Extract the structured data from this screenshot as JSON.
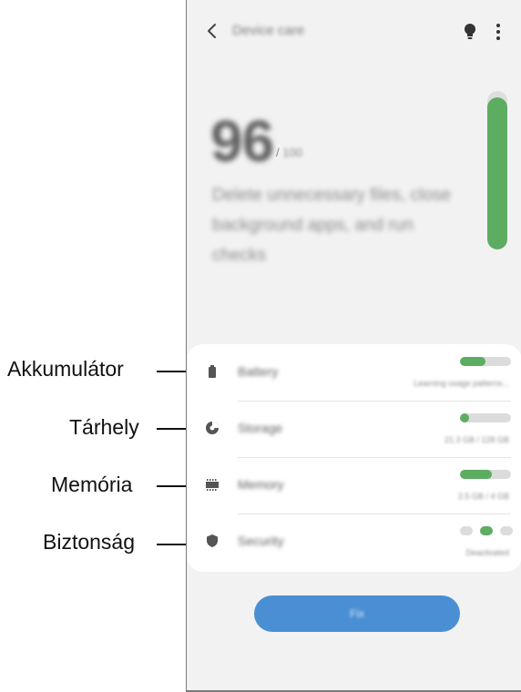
{
  "callouts": [
    {
      "label": "Akkumulátor"
    },
    {
      "label": "Tárhely"
    },
    {
      "label": "Memória"
    },
    {
      "label": "Biztonság"
    }
  ],
  "header": {
    "title": "Device care",
    "icons": [
      "back-icon",
      "lightbulb-icon",
      "more-options-icon"
    ]
  },
  "summary": {
    "score": "96",
    "score_max": "100",
    "message": "Delete unnecessary files, close background apps, and run checks",
    "score_fraction": 0.96
  },
  "items": [
    {
      "icon": "battery-icon",
      "label": "Battery",
      "status": "Learning usage patterns...",
      "level": 0.5
    },
    {
      "icon": "storage-icon",
      "label": "Storage",
      "status": "21.3 GB / 128 GB",
      "level": 0.17
    },
    {
      "icon": "memory-icon",
      "label": "Memory",
      "status": "2.5 GB / 4 GB",
      "level": 0.62
    },
    {
      "icon": "security-icon",
      "label": "Security",
      "status": "Deactivated",
      "level_dots": 3,
      "active_dot": 2
    }
  ],
  "action": {
    "label": "Fix"
  },
  "colors": {
    "accent_green": "#5cad62",
    "button_blue": "#4a8fd3",
    "background": "#f2f2f2"
  }
}
